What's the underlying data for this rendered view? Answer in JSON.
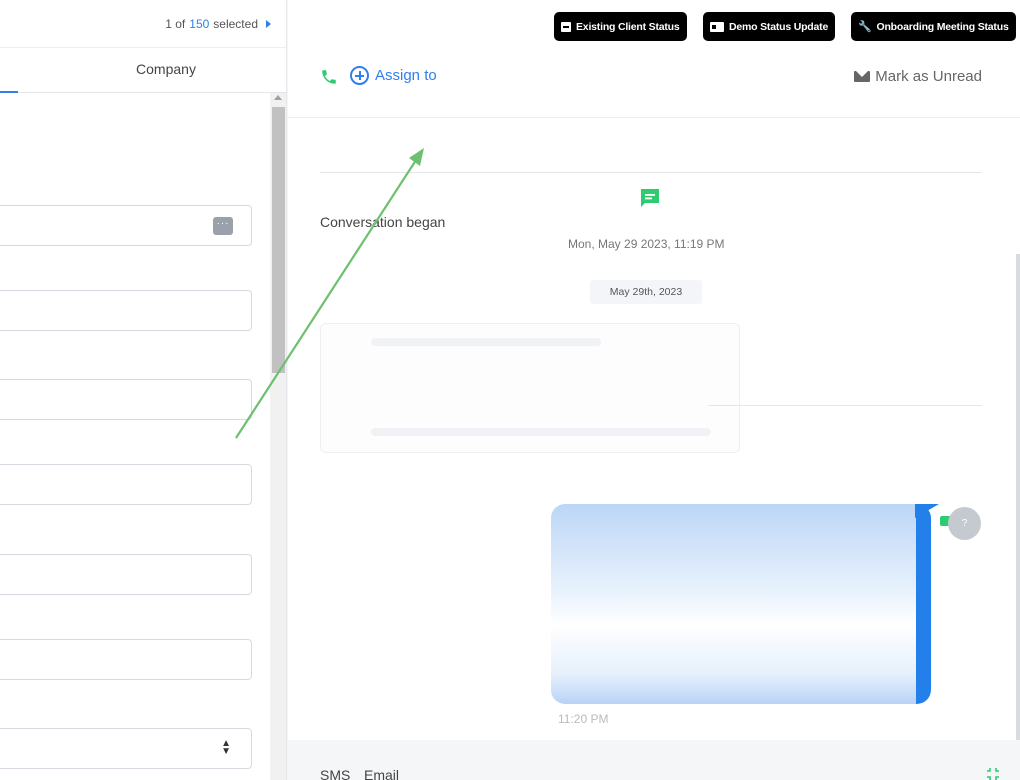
{
  "selection": {
    "prefix": "1 of",
    "count": "150",
    "suffix": "selected"
  },
  "left_tabs": {
    "company": "Company"
  },
  "toolbar": {
    "pills": [
      {
        "label": "Existing Client Status",
        "icon": "card-icon"
      },
      {
        "label": "Demo Status Update",
        "icon": "id-card-icon"
      },
      {
        "label": "Onboarding Meeting Status",
        "icon": "wrench-icon"
      }
    ],
    "assign_label": "Assign to",
    "mark_unread_label": "Mark as Unread"
  },
  "conversation": {
    "began_label": "Conversation began",
    "began_time": "Mon, May 29 2023, 11:19 PM",
    "date_divider": "May 29th, 2023",
    "message_time": "11:20 PM",
    "avatar_initial": "?"
  },
  "footer": {
    "tabs": [
      "SMS",
      "Email"
    ]
  },
  "colors": {
    "accent": "#2f80ed",
    "green": "#2ecc71",
    "bubble_edge": "#2380ea",
    "arrow": "#6cc070"
  }
}
